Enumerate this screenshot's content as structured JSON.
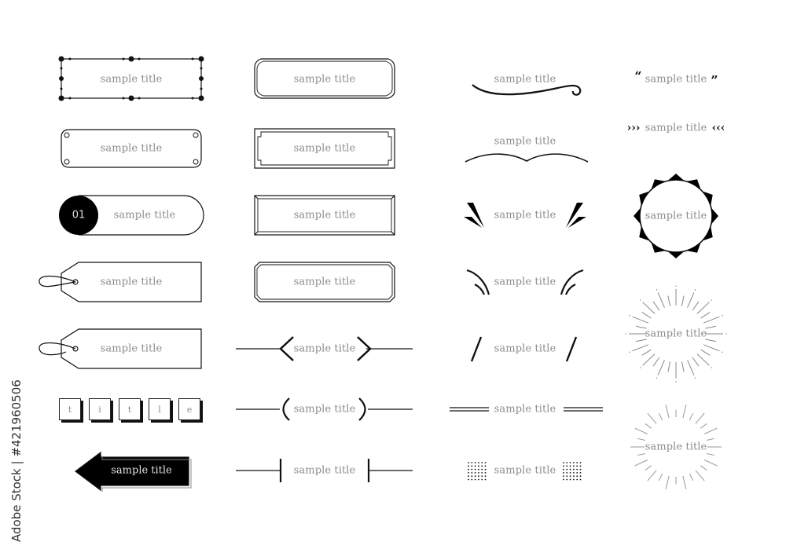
{
  "image_description": "Set of decorative title frame and heading ornament designs with placeholder text",
  "placeholder_text": "sample title",
  "colors": {
    "line": "#111111",
    "text": "#8c8c8c",
    "background": "#ffffff",
    "ray": "#9a9a9a"
  },
  "columns": {
    "col1": [
      {
        "name": "dotted-rect-frame",
        "label": "sample title"
      },
      {
        "name": "scroll-corner-frame",
        "label": "sample title"
      },
      {
        "name": "numbered-pill",
        "number": "01",
        "label": "sample title"
      },
      {
        "name": "tag-label",
        "label": "sample title"
      },
      {
        "name": "tag-label-2",
        "label": "sample title"
      },
      {
        "name": "letter-keys",
        "letters": [
          "t",
          "i",
          "t",
          "l",
          "e"
        ]
      },
      {
        "name": "arrow-banner",
        "label": "sample title"
      }
    ],
    "col2": [
      {
        "name": "notched-double-frame",
        "label": "sample title"
      },
      {
        "name": "inset-double-frame",
        "label": "sample title"
      },
      {
        "name": "beveled-frame",
        "label": "sample title"
      },
      {
        "name": "chamfered-frame",
        "label": "sample title"
      },
      {
        "name": "chevron-divider",
        "label": "sample title"
      },
      {
        "name": "parenthesis-divider",
        "label": "sample title"
      },
      {
        "name": "bar-divider",
        "label": "sample title"
      }
    ],
    "col3": [
      {
        "name": "swash-underline",
        "label": "sample title"
      },
      {
        "name": "wave-underline",
        "label": "sample title"
      },
      {
        "name": "spike-accents",
        "label": "sample title"
      },
      {
        "name": "curved-accents",
        "label": "sample title"
      },
      {
        "name": "slash-accents",
        "label": "sample title"
      },
      {
        "name": "double-line-divider",
        "label": "sample title"
      },
      {
        "name": "dot-grid-divider",
        "label": "sample title"
      }
    ],
    "col4": [
      {
        "name": "quote-marks",
        "open": "“",
        "close": "”",
        "label": "sample title"
      },
      {
        "name": "triple-chevrons",
        "left": "›››",
        "right": "‹‹‹",
        "label": "sample title"
      },
      {
        "name": "star-ring-badge",
        "label": "sample title"
      },
      {
        "name": "sunburst-lines",
        "label": "sample title"
      },
      {
        "name": "sunburst-dashes",
        "label": "sample title"
      }
    ]
  },
  "watermark_credit": "Adobe Stock | #421960506"
}
